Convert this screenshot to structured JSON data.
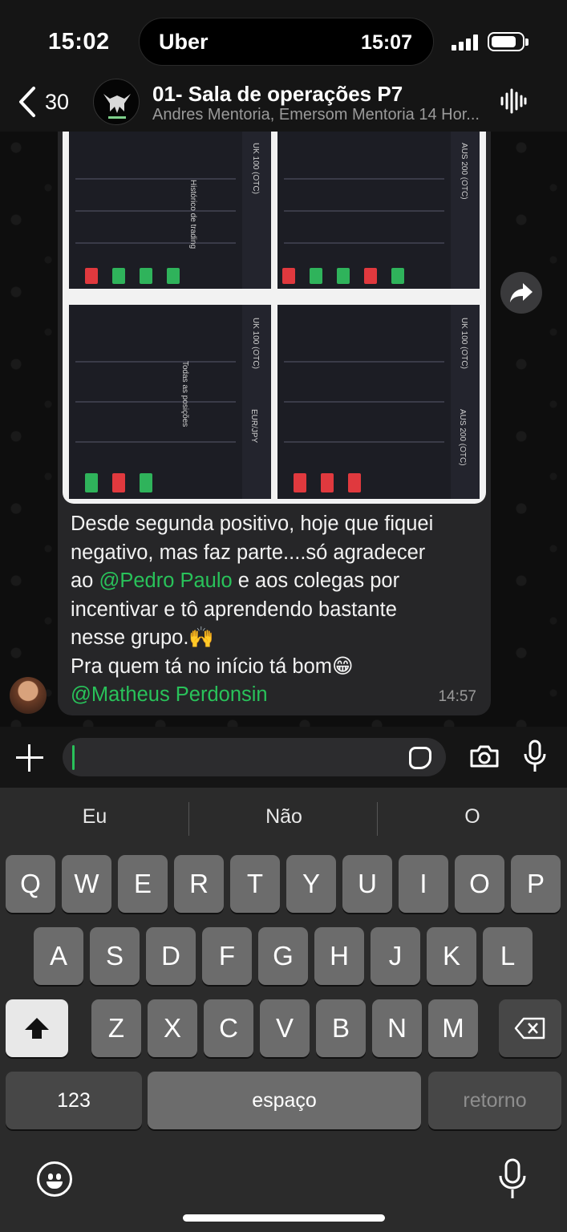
{
  "status_bar": {
    "time": "15:02",
    "island_app": "Uber",
    "island_time": "15:07"
  },
  "header": {
    "back_count": "30",
    "title": "01- Sala de operações P7",
    "subtitle": "Andres Mentoria, Emersom Mentoria 14 Hor..."
  },
  "message": {
    "line1": "Desde segunda positivo, hoje que fiquei",
    "line2": "negativo, mas faz parte....só agradecer",
    "line3_prefix": "ao ",
    "mention1": "@Pedro Paulo",
    "line3_suffix": " e aos colegas por",
    "line4": "incentivar e tô aprendendo bastante",
    "line5": "nesse grupo.🙌",
    "line6": "Pra quem tá no início tá bom😁",
    "mention2": "@Matheus Perdonsin",
    "time": "14:57"
  },
  "media": {
    "labels": [
      "UK 100 (OTC)",
      "AUS 200 (OTC)",
      "Histórico de trading",
      "Todas as posições",
      "EUR/JPY"
    ]
  },
  "keyboard": {
    "suggestions": [
      "Eu",
      "Não",
      "O"
    ],
    "row1": [
      "Q",
      "W",
      "E",
      "R",
      "T",
      "Y",
      "U",
      "I",
      "O",
      "P"
    ],
    "row2": [
      "A",
      "S",
      "D",
      "F",
      "G",
      "H",
      "J",
      "K",
      "L"
    ],
    "row3": [
      "Z",
      "X",
      "C",
      "V",
      "B",
      "N",
      "M"
    ],
    "numbers_key": "123",
    "space_key": "espaço",
    "return_key": "retorno"
  },
  "colors": {
    "mention": "#29c25a",
    "bubble": "#262628",
    "background": "#0e0e0e"
  }
}
